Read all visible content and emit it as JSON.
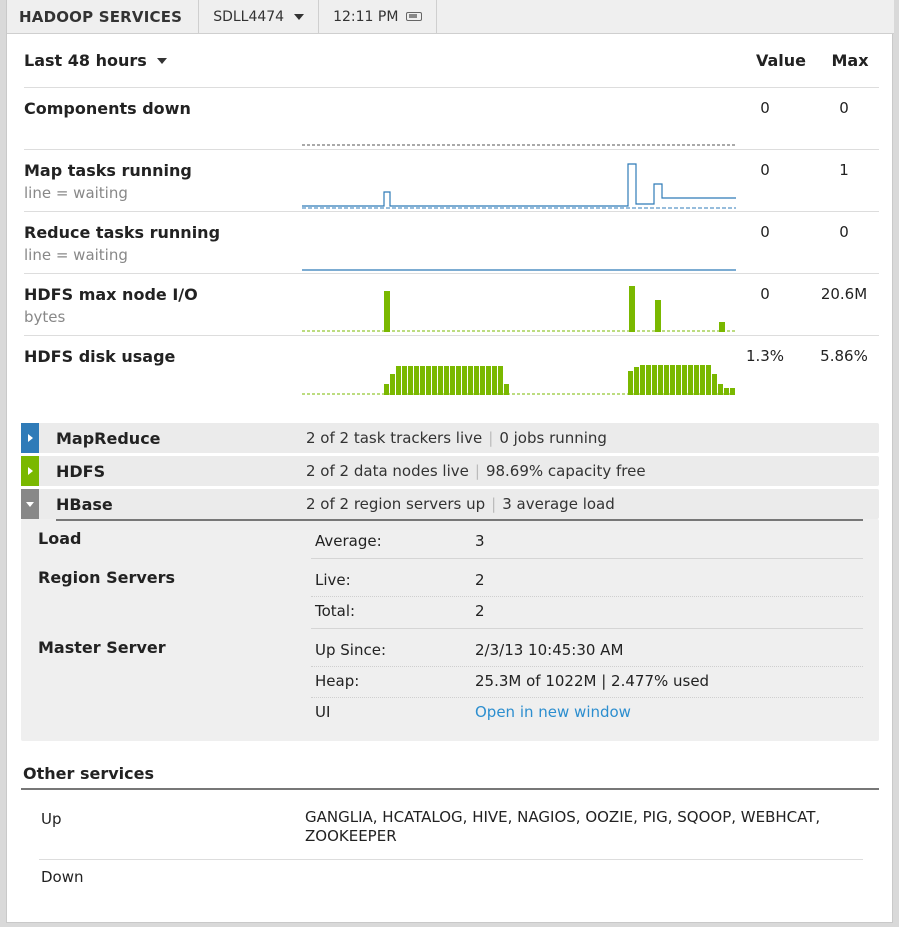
{
  "topbar": {
    "title": "HADOOP SERVICES",
    "cluster": "SDLL4474",
    "time": "12:11 PM"
  },
  "metrics": {
    "range": "Last 48 hours",
    "value_header": "Value",
    "max_header": "Max",
    "rows": [
      {
        "label": "Components down",
        "sublabel": "",
        "value": "0",
        "max": "0"
      },
      {
        "label": "Map tasks running",
        "sublabel": "line = waiting",
        "value": "0",
        "max": "1"
      },
      {
        "label": "Reduce tasks running",
        "sublabel": "line = waiting",
        "value": "0",
        "max": "0"
      },
      {
        "label": "HDFS max node I/O",
        "sublabel": "bytes",
        "value": "0",
        "max": "20.6M"
      },
      {
        "label": "HDFS disk usage",
        "sublabel": "",
        "value": "1.3%",
        "max": "5.86%"
      }
    ]
  },
  "colors": {
    "sparkline_blue": "#2f7bb8",
    "sparkline_green": "#7ab800",
    "mapreduce_accent": "#2f7bb8",
    "hdfs_accent": "#7ab800",
    "hbase_accent": "#888888",
    "link": "#2c8ecf"
  },
  "services": [
    {
      "name": "MapReduce",
      "part1": "2 of 2 task trackers live",
      "part2": "0 jobs running",
      "state": "collapsed"
    },
    {
      "name": "HDFS",
      "part1": "2 of 2 data nodes live",
      "part2": "98.69% capacity free",
      "state": "collapsed"
    },
    {
      "name": "HBase",
      "part1": "2 of 2 region servers up",
      "part2": "3 average load",
      "state": "expanded"
    }
  ],
  "hbase": {
    "load": {
      "title": "Load",
      "average_label": "Average:",
      "average_value": "3"
    },
    "region_servers": {
      "title": "Region Servers",
      "live_label": "Live:",
      "live_value": "2",
      "total_label": "Total:",
      "total_value": "2"
    },
    "master": {
      "title": "Master Server",
      "up_label": "Up Since:",
      "up_value": "2/3/13 10:45:30 AM",
      "heap_label": "Heap:",
      "heap_value": "25.3M of 1022M | 2.477% used",
      "ui_label": "UI",
      "ui_link": "Open in new window"
    }
  },
  "other_services": {
    "title": "Other services",
    "up_label": "Up",
    "up_value": "GANGLIA, HCATALOG, HIVE, NAGIOS, OOZIE, PIG, SQOOP, WEBHCAT, ZOOKEEPER",
    "down_label": "Down",
    "down_value": ""
  }
}
